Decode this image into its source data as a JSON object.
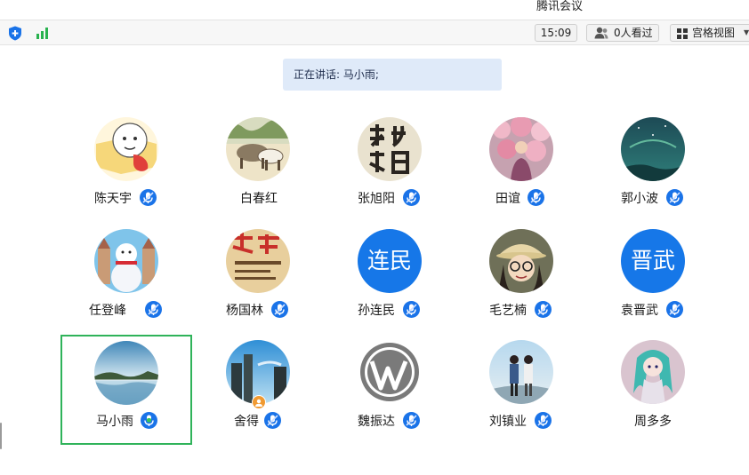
{
  "window": {
    "title": "腾讯会议"
  },
  "toolbar": {
    "time": "15:09",
    "viewers": "0人看过",
    "view_mode": "宫格视图",
    "icons": [
      "shield-icon",
      "signal-strength-icon",
      "person-icon",
      "grid-icon",
      "caret-down-icon"
    ]
  },
  "speaking": {
    "text": "正在讲话: 马小雨;"
  },
  "colors": {
    "accent": "#1a73e8",
    "active_border": "#2fb35a",
    "speaking_bg": "#dfeaf9",
    "badge": "#f09a32"
  },
  "participants": [
    {
      "name": "陈天宇",
      "mic": "muted",
      "avatar": "cartoon"
    },
    {
      "name": "白春红",
      "mic": "none",
      "avatar": "cattle"
    },
    {
      "name": "张旭阳",
      "mic": "muted",
      "avatar": "calligraphy"
    },
    {
      "name": "田谊",
      "mic": "muted",
      "avatar": "flowers"
    },
    {
      "name": "郭小波",
      "mic": "muted",
      "avatar": "night-sky"
    },
    {
      "name": "任登峰",
      "mic": "muted",
      "avatar": "snowman"
    },
    {
      "name": "杨国林",
      "mic": "muted",
      "avatar": "poster"
    },
    {
      "name": "孙连民",
      "mic": "muted",
      "avatar_text": "连民"
    },
    {
      "name": "毛艺楠",
      "mic": "muted",
      "avatar": "portrait"
    },
    {
      "name": "袁晋武",
      "mic": "muted",
      "avatar_text": "晋武"
    },
    {
      "name": "马小雨",
      "mic": "active",
      "avatar": "lake",
      "active": true
    },
    {
      "name": "舍得",
      "mic": "muted",
      "avatar": "city",
      "badge": "user-badge-icon"
    },
    {
      "name": "魏振达",
      "mic": "muted",
      "avatar": "wordpress"
    },
    {
      "name": "刘镇业",
      "mic": "muted",
      "avatar": "couple"
    },
    {
      "name": "周多多",
      "mic": "none",
      "avatar": "anime"
    }
  ]
}
